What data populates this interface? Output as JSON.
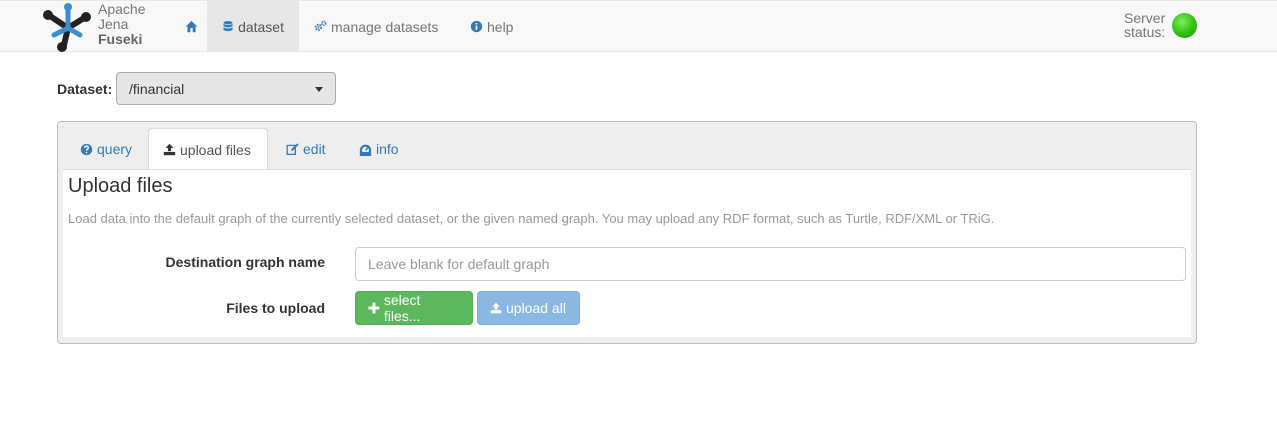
{
  "brand": {
    "line1": "Apache",
    "line2": "Jena",
    "line3": "Fuseki"
  },
  "nav": {
    "home_icon": "home-icon",
    "items": [
      {
        "label": "dataset",
        "icon": "database-icon",
        "active": true
      },
      {
        "label": "manage datasets",
        "icon": "cogs-icon",
        "active": false
      },
      {
        "label": "help",
        "icon": "info-circle-icon",
        "active": false
      }
    ]
  },
  "server_status": {
    "line1": "Server",
    "line2": "status:",
    "state_color": "#3cc81a"
  },
  "dataset": {
    "label": "Dataset:",
    "selected": "/financial"
  },
  "tabs": [
    {
      "label": "query",
      "icon": "question-circle-icon",
      "active": false
    },
    {
      "label": "upload files",
      "icon": "upload-icon",
      "active": true
    },
    {
      "label": "edit",
      "icon": "edit-icon",
      "active": false
    },
    {
      "label": "info",
      "icon": "dashboard-icon",
      "active": false
    }
  ],
  "upload": {
    "title": "Upload files",
    "description": "Load data into the default graph of the currently selected dataset, or the given named graph. You may upload any RDF format, such as Turtle, RDF/XML or TRiG.",
    "dest_label": "Destination graph name",
    "dest_placeholder": "Leave blank for default graph",
    "files_label": "Files to upload",
    "select_button": "select files...",
    "upload_button": "upload all"
  },
  "colors": {
    "accent": "#337ab7",
    "success": "#5cb85c",
    "upload_disabled": "#8ab8e0"
  }
}
